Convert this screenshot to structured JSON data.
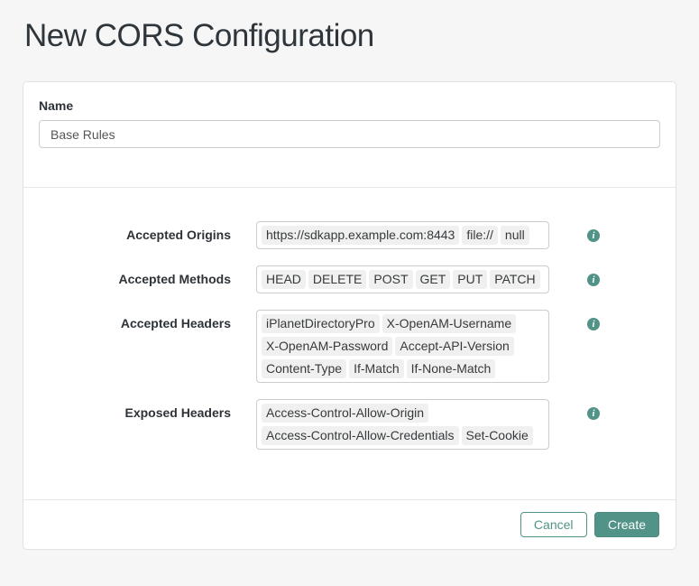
{
  "page": {
    "title": "New CORS Configuration"
  },
  "name_section": {
    "label": "Name",
    "value": "Base Rules"
  },
  "fields": [
    {
      "label": "Accepted Origins",
      "tags": [
        "https://sdkapp.example.com:8443",
        "file://",
        "null"
      ]
    },
    {
      "label": "Accepted Methods",
      "tags": [
        "HEAD",
        "DELETE",
        "POST",
        "GET",
        "PUT",
        "PATCH"
      ]
    },
    {
      "label": "Accepted Headers",
      "tags": [
        "iPlanetDirectoryPro",
        "X-OpenAM-Username",
        "X-OpenAM-Password",
        "Accept-API-Version",
        "Content-Type",
        "If-Match",
        "If-None-Match"
      ]
    },
    {
      "label": "Exposed Headers",
      "tags": [
        "Access-Control-Allow-Origin",
        "Access-Control-Allow-Credentials",
        "Set-Cookie"
      ]
    }
  ],
  "footer": {
    "cancel_label": "Cancel",
    "create_label": "Create"
  },
  "icons": {
    "info_glyph": "i"
  },
  "colors": {
    "accent_teal": "#519387",
    "tag_background": "#f0f0f0",
    "page_background": "#f6f6f7",
    "input_border": "#cccccc"
  }
}
